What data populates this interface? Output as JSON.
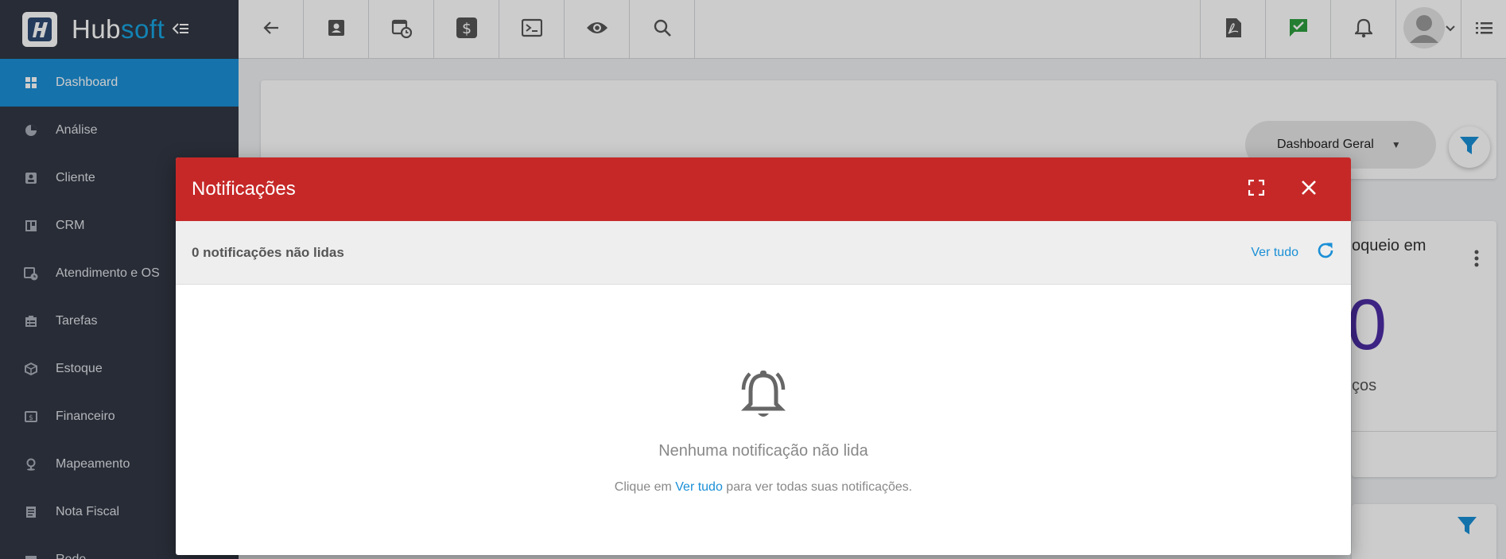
{
  "app": {
    "logo_text_a": "Hub",
    "logo_text_b": "soft",
    "brand_color": "#17a4e2"
  },
  "sidebar": {
    "items": [
      {
        "label": "Dashboard",
        "icon": "dashboard-icon",
        "active": true
      },
      {
        "label": "Análise",
        "icon": "pie-chart-icon"
      },
      {
        "label": "Cliente",
        "icon": "contact-card-icon"
      },
      {
        "label": "CRM",
        "icon": "kanban-icon"
      },
      {
        "label": "Atendimento e OS",
        "icon": "calendar-clock-icon"
      },
      {
        "label": "Tarefas",
        "icon": "tasks-icon"
      },
      {
        "label": "Estoque",
        "icon": "box-icon"
      },
      {
        "label": "Financeiro",
        "icon": "money-icon"
      },
      {
        "label": "Mapeamento",
        "icon": "map-pin-icon"
      },
      {
        "label": "Nota Fiscal",
        "icon": "invoice-icon"
      },
      {
        "label": "Rede",
        "icon": "network-icon"
      }
    ]
  },
  "topbar": {
    "icons": [
      "back-arrow-icon",
      "contact-card-icon",
      "calendar-clock-icon",
      "dollar-icon",
      "terminal-icon",
      "eye-icon",
      "search-icon"
    ],
    "right_icons": [
      "pdf-icon",
      "chat-check-icon",
      "bell-icon",
      "avatar",
      "list-icon"
    ],
    "chat_color": "#2e9e3e"
  },
  "dashboard": {
    "select_value": "Dashboard Geral",
    "card_title_fragment": "oqueio em",
    "card_number_fragment": "0",
    "card_sub_fragment": "ços"
  },
  "modal": {
    "title": "Notificações",
    "unread_label": "0 notificações não lidas",
    "view_all": "Ver tudo",
    "empty_title": "Nenhuma notificação não lida",
    "hint_prefix": "Clique em ",
    "hint_link": "Ver tudo",
    "hint_suffix": " para ver todas suas notificações.",
    "header_color": "#c62828"
  }
}
